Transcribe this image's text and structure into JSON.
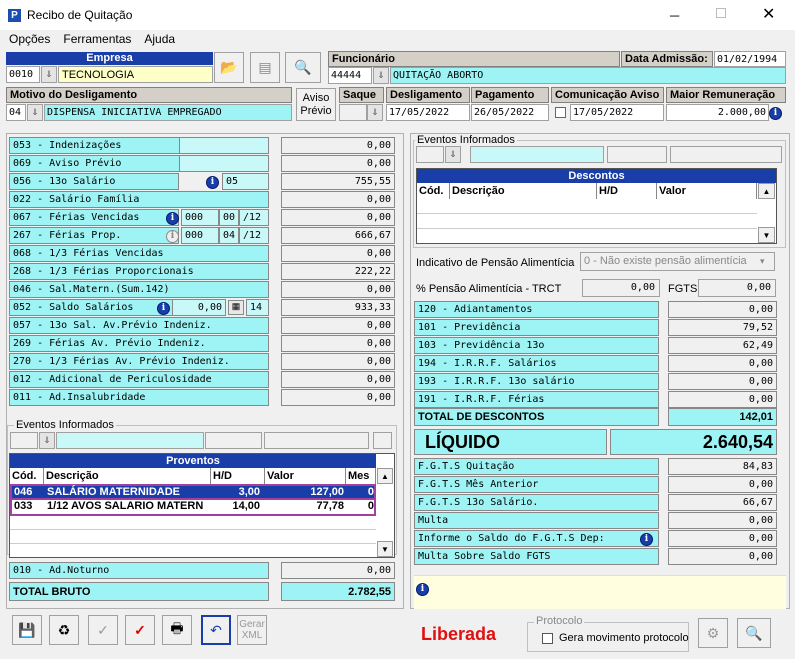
{
  "window": {
    "title": "Recibo de Quitação"
  },
  "menu": [
    "Opções",
    "Ferramentas",
    "Ajuda"
  ],
  "empresa": {
    "label": "Empresa",
    "code": "0010",
    "name": "TECNOLOGIA"
  },
  "funcionario": {
    "label": "Funcionário",
    "code": "44444",
    "name": "QUITAÇÃO ABORTO"
  },
  "admissao": {
    "label": "Data Admissão:",
    "value": "01/02/1994"
  },
  "motivo": {
    "label": "Motivo do Desligamento",
    "code": "04",
    "value": "DISPENSA INICIATIVA EMPREGADO"
  },
  "aviso_previo": {
    "line1": "Aviso",
    "line2": "Prévio"
  },
  "saque": {
    "label": "Saque"
  },
  "desligamento": {
    "label": "Desligamento",
    "value": "17/05/2022"
  },
  "pagamento": {
    "label": "Pagamento",
    "value": "26/05/2022"
  },
  "comunicacao": {
    "label": "Comunicação Aviso",
    "value": "17/05/2022"
  },
  "remuneracao": {
    "label": "Maior Remuneração",
    "value": "2.000,00"
  },
  "proventos_left": [
    {
      "label": "053 - Indenizações",
      "value": "0,00"
    },
    {
      "label": "069 - Aviso Prévio",
      "value": "0,00"
    },
    {
      "label": "056 - 13o Salário",
      "extra": "05",
      "value": "755,55"
    },
    {
      "label": "022 - Salário Família",
      "value": "0,00"
    },
    {
      "label": "067 - Férias Vencidas",
      "extra1": "000",
      "extra2": "00",
      "extra3": "/12",
      "value": "0,00"
    },
    {
      "label": "267 - Férias Prop.",
      "extra1": "000",
      "extra2": "04",
      "extra3": "/12",
      "value": "666,67"
    },
    {
      "label": "068 - 1/3 Férias Vencidas",
      "value": "0,00"
    },
    {
      "label": "268 - 1/3 Férias Proporcionais",
      "value": "222,22"
    },
    {
      "label": "046 - Sal.Matern.(Sum.142)",
      "value": "0,00"
    },
    {
      "label": "052 - Saldo Salários",
      "extra1": "0,00",
      "extra2": "14",
      "value": "933,33"
    },
    {
      "label": "057 - 13o Sal. Av.Prévio Indeniz.",
      "value": "0,00"
    },
    {
      "label": "269 - Férias Av. Prévio Indeniz.",
      "value": "0,00"
    },
    {
      "label": "270 - 1/3 Férias Av. Prévio Indeniz.",
      "value": "0,00"
    },
    {
      "label": "012 - Adicional de Periculosidade",
      "value": "0,00"
    },
    {
      "label": "011 - Ad.Insalubridade",
      "value": "0,00"
    }
  ],
  "eventos_left": {
    "label": "Eventos Informados"
  },
  "proventos_table": {
    "title": "Proventos",
    "headers": [
      "Cód.",
      "Descrição",
      "H/D",
      "Valor",
      "Mes"
    ],
    "rows": [
      {
        "cod": "046",
        "desc": "SALÁRIO MATERNIDADE",
        "hd": "3,00",
        "valor": "127,00",
        "mes": "0"
      },
      {
        "cod": "033",
        "desc": "1/12 AVOS SALARIO MATERN",
        "hd": "14,00",
        "valor": "77,78",
        "mes": "0"
      }
    ]
  },
  "ad_noturno": {
    "label": "010 - Ad.Noturno",
    "value": "0,00"
  },
  "total_bruto": {
    "label": "TOTAL BRUTO",
    "value": "2.782,55"
  },
  "eventos_right": {
    "label": "Eventos Informados"
  },
  "descontos_table": {
    "title": "Descontos",
    "headers": [
      "Cód.",
      "Descrição",
      "H/D",
      "Valor"
    ]
  },
  "pensao": {
    "label": "Indicativo de Pensão Alimentícia",
    "value": "0 - Não existe pensão alimentícia"
  },
  "pensao_trct": {
    "label": "% Pensão Alimentícia - TRCT",
    "value": "0,00"
  },
  "fgts": {
    "label": "FGTS",
    "value": "0,00"
  },
  "descontos_list": [
    {
      "label": "120 - Adiantamentos",
      "value": "0,00"
    },
    {
      "label": "101 - Previdência",
      "value": "79,52"
    },
    {
      "label": "103 - Previdência 13o",
      "value": "62,49"
    },
    {
      "label": "194 - I.R.R.F. Salários",
      "value": "0,00"
    },
    {
      "label": "193 - I.R.R.F. 13o salário",
      "value": "0,00"
    },
    {
      "label": "191 - I.R.R.F. Férias",
      "value": "0,00"
    }
  ],
  "total_descontos": {
    "label": "TOTAL DE DESCONTOS",
    "value": "142,01"
  },
  "liquido": {
    "label": "LÍQUIDO",
    "value": "2.640,54"
  },
  "fgts_list": [
    {
      "label": "F.G.T.S  Quitação",
      "value": "84,83"
    },
    {
      "label": "F.G.T.S  Mês Anterior",
      "value": "0,00"
    },
    {
      "label": "F.G.T.S  13o Salário.",
      "value": "66,67"
    },
    {
      "label": "Multa",
      "value": "0,00"
    },
    {
      "label": "Informe o Saldo do F.G.T.S Dep:",
      "value": "0,00"
    },
    {
      "label": "Multa Sobre Saldo FGTS",
      "value": "0,00"
    }
  ],
  "status": {
    "value": "Liberada",
    "color": "#e01010"
  },
  "protocolo": {
    "label": "Protocolo",
    "checkbox": "Gera movimento protocolo"
  },
  "toolbar": {
    "gerar_xml_1": "Gerar",
    "gerar_xml_2": "XML"
  }
}
